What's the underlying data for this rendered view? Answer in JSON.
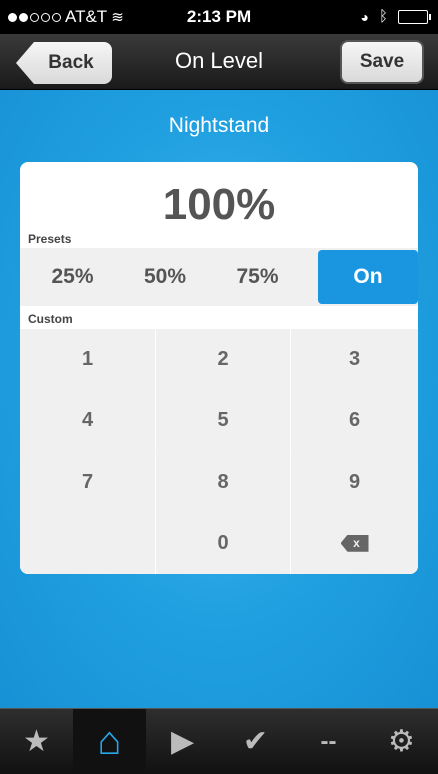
{
  "status_bar": {
    "carrier": "AT&T",
    "time": "2:13 PM"
  },
  "nav": {
    "back_label": "Back",
    "title": "On Level",
    "save_label": "Save"
  },
  "device_name": "Nightstand",
  "level": "100%",
  "presets": {
    "label": "Presets",
    "items": [
      "25%",
      "50%",
      "75%"
    ],
    "on_label": "On"
  },
  "custom": {
    "label": "Custom",
    "keys": [
      "1",
      "2",
      "3",
      "4",
      "5",
      "6",
      "7",
      "8",
      "9",
      "",
      "0"
    ],
    "backspace_glyph": "x"
  },
  "tabs": [
    {
      "name": "favorites",
      "icon": "star-icon",
      "glyph": "★"
    },
    {
      "name": "home",
      "icon": "home-icon",
      "glyph": "⌂"
    },
    {
      "name": "scenes",
      "icon": "clapperboard-icon",
      "glyph": "▶"
    },
    {
      "name": "status",
      "icon": "check-icon",
      "glyph": "✔"
    },
    {
      "name": "more",
      "icon": "dash-icon",
      "glyph": "--"
    },
    {
      "name": "settings",
      "icon": "gear-icon",
      "glyph": "⚙"
    }
  ],
  "colors": {
    "accent": "#1a95e0",
    "background": "#2aa8e8"
  }
}
